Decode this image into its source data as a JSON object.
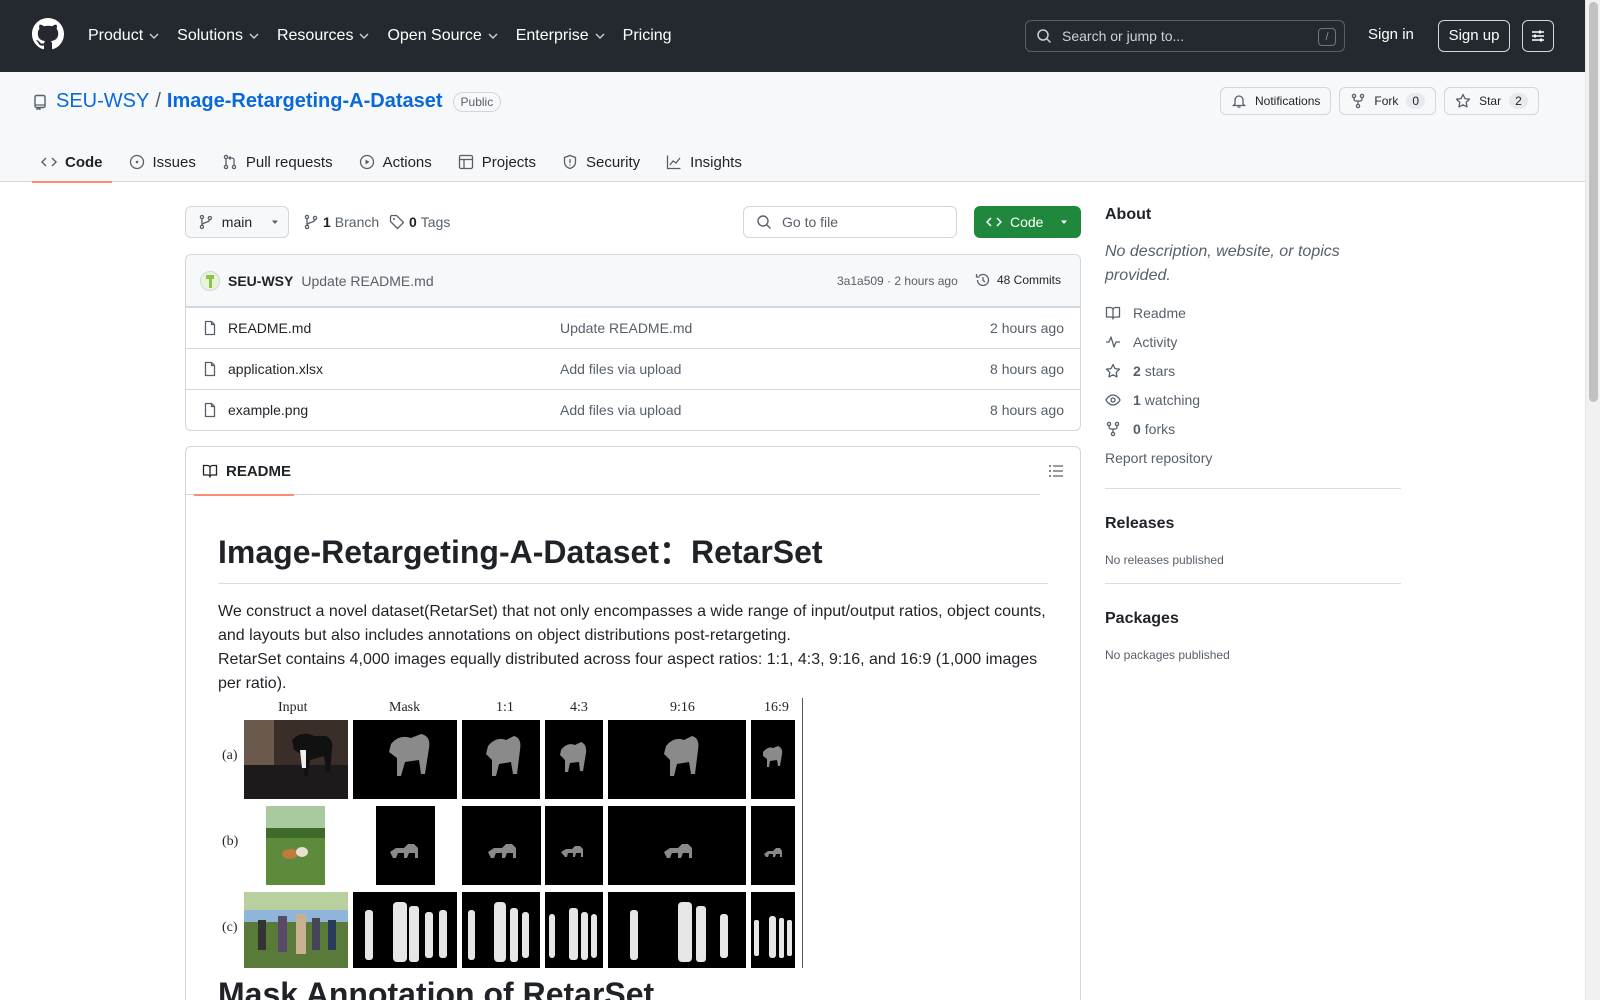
{
  "header": {
    "nav": [
      "Product",
      "Solutions",
      "Resources",
      "Open Source",
      "Enterprise",
      "Pricing"
    ],
    "search_placeholder": "Search or jump to...",
    "search_key": "/",
    "signin": "Sign in",
    "signup": "Sign up"
  },
  "repo": {
    "owner": "SEU-WSY",
    "separator": "/",
    "name": "Image-Retargeting-A-Dataset",
    "visibility": "Public",
    "notifications_label": "Notifications",
    "fork_label": "Fork",
    "fork_count": "0",
    "star_label": "Star",
    "star_count": "2"
  },
  "tabs": [
    "Code",
    "Issues",
    "Pull requests",
    "Actions",
    "Projects",
    "Security",
    "Insights"
  ],
  "browser": {
    "branch": "main",
    "branch_count": "1",
    "branch_label": "Branch",
    "tag_count": "0",
    "tag_label": "Tags",
    "goto_placeholder": "Go to file",
    "code_button": "Code",
    "commit": {
      "author": "SEU-WSY",
      "message": "Update README.md",
      "meta": "3a1a509 · 2 hours ago",
      "count": "48 Commits"
    },
    "files": [
      {
        "name": "README.md",
        "message": "Update README.md",
        "time": "2 hours ago"
      },
      {
        "name": "application.xlsx",
        "message": "Add files via upload",
        "time": "8 hours ago"
      },
      {
        "name": "example.png",
        "message": "Add files via upload",
        "time": "8 hours ago"
      }
    ]
  },
  "readme": {
    "tab": "README",
    "title": "Image-Retargeting-A-Dataset：RetarSet",
    "p1": "We construct a novel dataset(RetarSet) that not only encompasses a wide range of input/output ratios, object counts, and layouts but also includes annotations on object distributions post-retargeting.",
    "p2": "RetarSet contains 4,000 images equally distributed across four aspect ratios: 1:1, 4:3, 9:16, and 16:9 (1,000 images per ratio).",
    "figure": {
      "columns": [
        "Input",
        "Mask",
        "1:1",
        "4:3",
        "9:16",
        "16:9"
      ],
      "rows": [
        "(a)",
        "(b)",
        "(c)"
      ]
    },
    "h2_partial": "Mask Annotation of RetarSet"
  },
  "sidebar": {
    "about_title": "About",
    "about_desc": "No description, website, or topics provided.",
    "links": {
      "readme": "Readme",
      "activity": "Activity",
      "stars_count": "2",
      "stars_label": "stars",
      "watching_count": "1",
      "watching_label": "watching",
      "forks_count": "0",
      "forks_label": "forks",
      "report": "Report repository"
    },
    "releases_title": "Releases",
    "releases_text": "No releases published",
    "packages_title": "Packages",
    "packages_text": "No packages published"
  }
}
